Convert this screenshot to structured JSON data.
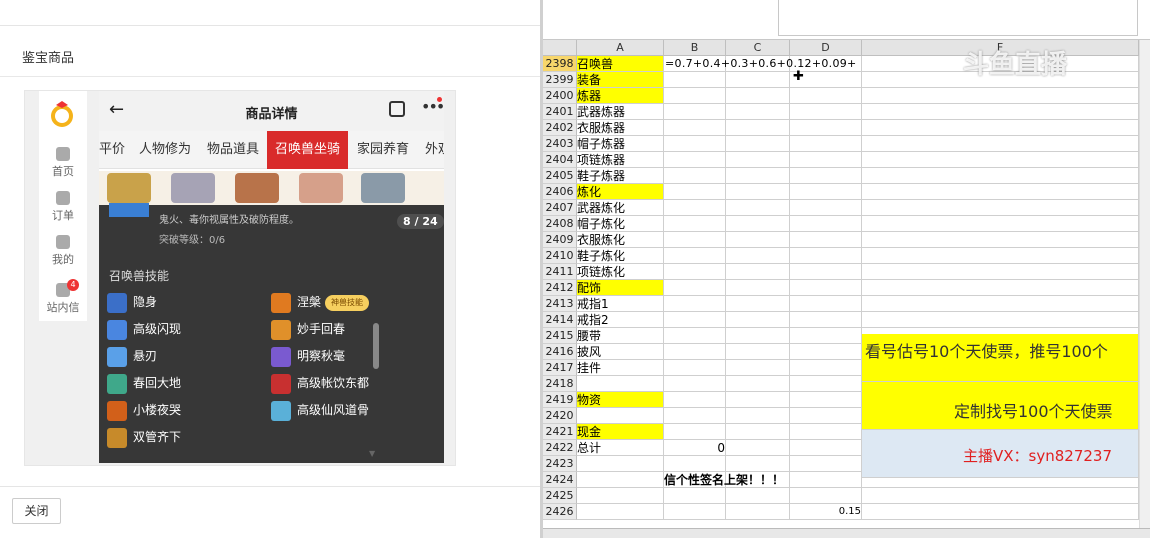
{
  "left_panel": {
    "title": "鉴宝商品",
    "close_label": "关闭",
    "sidebar": [
      {
        "label": "首页",
        "icon": "home-icon"
      },
      {
        "label": "订单",
        "icon": "order-icon"
      },
      {
        "label": "我的",
        "icon": "user-icon"
      },
      {
        "label": "站内信",
        "icon": "message-icon",
        "badge": "4"
      }
    ],
    "phone": {
      "header_title": "商品详情",
      "tabs": [
        "平价",
        "人物修为",
        "物品道具",
        "召唤兽坐骑",
        "家园养育",
        "外观"
      ],
      "active_tab": "召唤兽坐骑",
      "overlay": {
        "desc_line1": "鬼火、毒你视属性及破防程度。",
        "desc_line2": "突破等级：0/6",
        "pager": "8 / 24",
        "section_title": "召唤兽技能",
        "skills_left": [
          "隐身",
          "高级闪现",
          "悬刃",
          "春回大地",
          "小楼夜哭",
          "双管齐下"
        ],
        "skills_right": [
          "涅槃",
          "妙手回春",
          "明察秋毫",
          "高级帐饮东都",
          "高级仙风道骨"
        ],
        "tag_label": "神兽技能"
      }
    }
  },
  "spreadsheet": {
    "columns": [
      "A",
      "B",
      "C",
      "D",
      "F"
    ],
    "formula_text": "=0.7+0.4+0.3+0.6+0.12+0.09+",
    "rows": [
      {
        "num": "2398",
        "a": "召唤兽",
        "yellow": true,
        "selected": true
      },
      {
        "num": "2399",
        "a": "装备",
        "yellow": true
      },
      {
        "num": "2400",
        "a": "炼器",
        "yellow": true
      },
      {
        "num": "2401",
        "a": "武器炼器"
      },
      {
        "num": "2402",
        "a": "衣服炼器"
      },
      {
        "num": "2403",
        "a": "帽子炼器"
      },
      {
        "num": "2404",
        "a": "项链炼器"
      },
      {
        "num": "2405",
        "a": "鞋子炼器"
      },
      {
        "num": "2406",
        "a": "炼化",
        "yellow": true
      },
      {
        "num": "2407",
        "a": "武器炼化"
      },
      {
        "num": "2408",
        "a": "帽子炼化"
      },
      {
        "num": "2409",
        "a": "衣服炼化"
      },
      {
        "num": "2410",
        "a": "鞋子炼化"
      },
      {
        "num": "2411",
        "a": "项链炼化"
      },
      {
        "num": "2412",
        "a": "配饰",
        "yellow": true
      },
      {
        "num": "2413",
        "a": "戒指1"
      },
      {
        "num": "2414",
        "a": "戒指2"
      },
      {
        "num": "2415",
        "a": "腰带"
      },
      {
        "num": "2416",
        "a": "披风"
      },
      {
        "num": "2417",
        "a": "挂件"
      },
      {
        "num": "2418",
        "a": ""
      },
      {
        "num": "2419",
        "a": "物资",
        "yellow": true
      },
      {
        "num": "2420",
        "a": ""
      },
      {
        "num": "2421",
        "a": "现金",
        "yellow": true
      },
      {
        "num": "2422",
        "a": "总计",
        "b": "0"
      },
      {
        "num": "2423",
        "a": ""
      },
      {
        "num": "2424",
        "a": "",
        "b": "信个性签名上架！！！"
      },
      {
        "num": "2425",
        "a": ""
      },
      {
        "num": "2426",
        "a": "",
        "d": "0.15"
      }
    ],
    "f_text1": "看号估号10个天使票，推号100个",
    "f_text2": "定制找号100个天使票",
    "f_text3": "主播VX：syn827237",
    "watermark": "斗鱼直播"
  },
  "colors": {
    "yellow": "#ffff00",
    "tab_active": "#d92b2b",
    "vx_red": "#e02020"
  }
}
